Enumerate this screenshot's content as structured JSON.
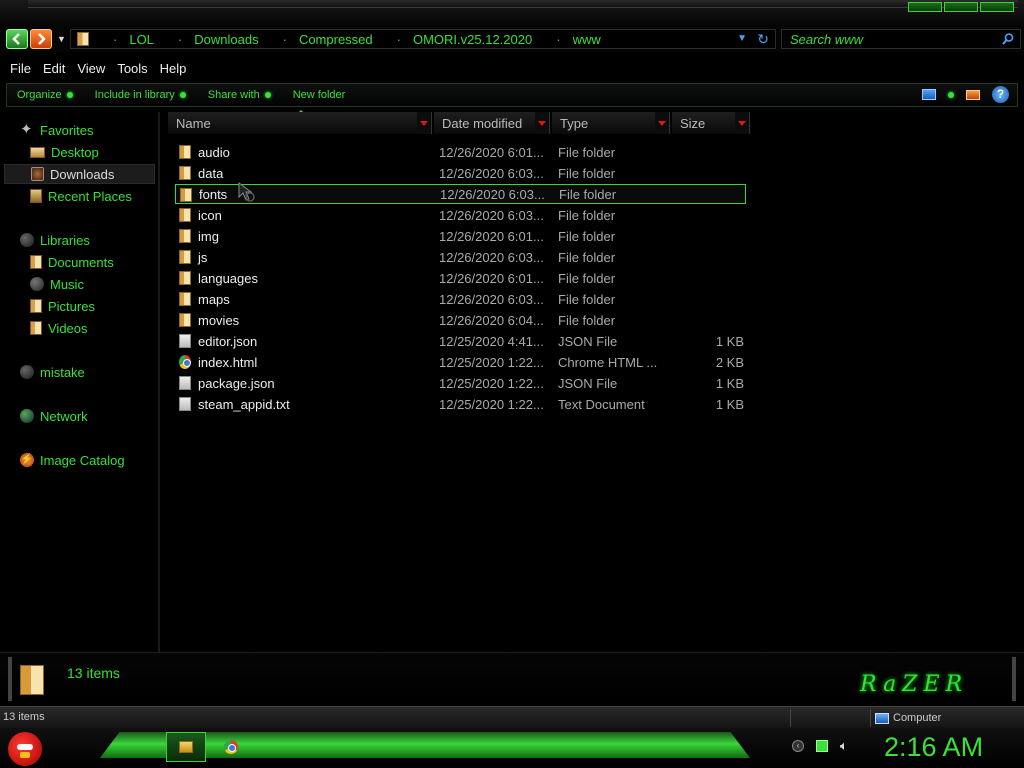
{
  "window": {
    "breadcrumbs": [
      "LOL",
      "Downloads",
      "Compressed",
      "OMORI.v25.12.2020",
      "www"
    ],
    "search_placeholder": "Search www"
  },
  "menu": [
    "File",
    "Edit",
    "View",
    "Tools",
    "Help"
  ],
  "toolbar": {
    "organize": "Organize",
    "include": "Include in library",
    "share": "Share with",
    "new_folder": "New folder"
  },
  "nav": {
    "favorites": "Favorites",
    "desktop": "Desktop",
    "downloads": "Downloads",
    "recent": "Recent Places",
    "libraries": "Libraries",
    "documents": "Documents",
    "music": "Music",
    "pictures": "Pictures",
    "videos": "Videos",
    "mistake": "mistake",
    "network": "Network",
    "image_catalog": "Image Catalog"
  },
  "columns": {
    "name": "Name",
    "date": "Date modified",
    "type": "Type",
    "size": "Size"
  },
  "files": [
    {
      "name": "audio",
      "date": "12/26/2020 6:01...",
      "type": "File folder",
      "size": "",
      "icon": "folder-icon"
    },
    {
      "name": "data",
      "date": "12/26/2020 6:03...",
      "type": "File folder",
      "size": "",
      "icon": "folder-icon"
    },
    {
      "name": "fonts",
      "date": "12/26/2020 6:03...",
      "type": "File folder",
      "size": "",
      "icon": "folder-icon"
    },
    {
      "name": "icon",
      "date": "12/26/2020 6:03...",
      "type": "File folder",
      "size": "",
      "icon": "folder-icon"
    },
    {
      "name": "img",
      "date": "12/26/2020 6:01...",
      "type": "File folder",
      "size": "",
      "icon": "folder-icon"
    },
    {
      "name": "js",
      "date": "12/26/2020 6:03...",
      "type": "File folder",
      "size": "",
      "icon": "folder-icon"
    },
    {
      "name": "languages",
      "date": "12/26/2020 6:01...",
      "type": "File folder",
      "size": "",
      "icon": "folder-icon"
    },
    {
      "name": "maps",
      "date": "12/26/2020 6:03...",
      "type": "File folder",
      "size": "",
      "icon": "folder-icon"
    },
    {
      "name": "movies",
      "date": "12/26/2020 6:04...",
      "type": "File folder",
      "size": "",
      "icon": "folder-icon"
    },
    {
      "name": "editor.json",
      "date": "12/25/2020 4:41...",
      "type": "JSON File",
      "size": "1 KB",
      "icon": "file-icon"
    },
    {
      "name": "index.html",
      "date": "12/25/2020 1:22...",
      "type": "Chrome HTML ...",
      "size": "2 KB",
      "icon": "chrome-icon"
    },
    {
      "name": "package.json",
      "date": "12/25/2020 1:22...",
      "type": "JSON File",
      "size": "1 KB",
      "icon": "file-icon"
    },
    {
      "name": "steam_appid.txt",
      "date": "12/25/2020 1:22...",
      "type": "Text Document",
      "size": "1 KB",
      "icon": "file-icon"
    }
  ],
  "selected_index": 2,
  "details": {
    "count": "13 items",
    "brand": "RaZER"
  },
  "status": {
    "items": "13 items",
    "location": "Computer"
  },
  "taskbar": {
    "clock": "2:16 AM"
  },
  "colors": {
    "accent": "#38e038",
    "sort_arrow": "#e01515"
  }
}
